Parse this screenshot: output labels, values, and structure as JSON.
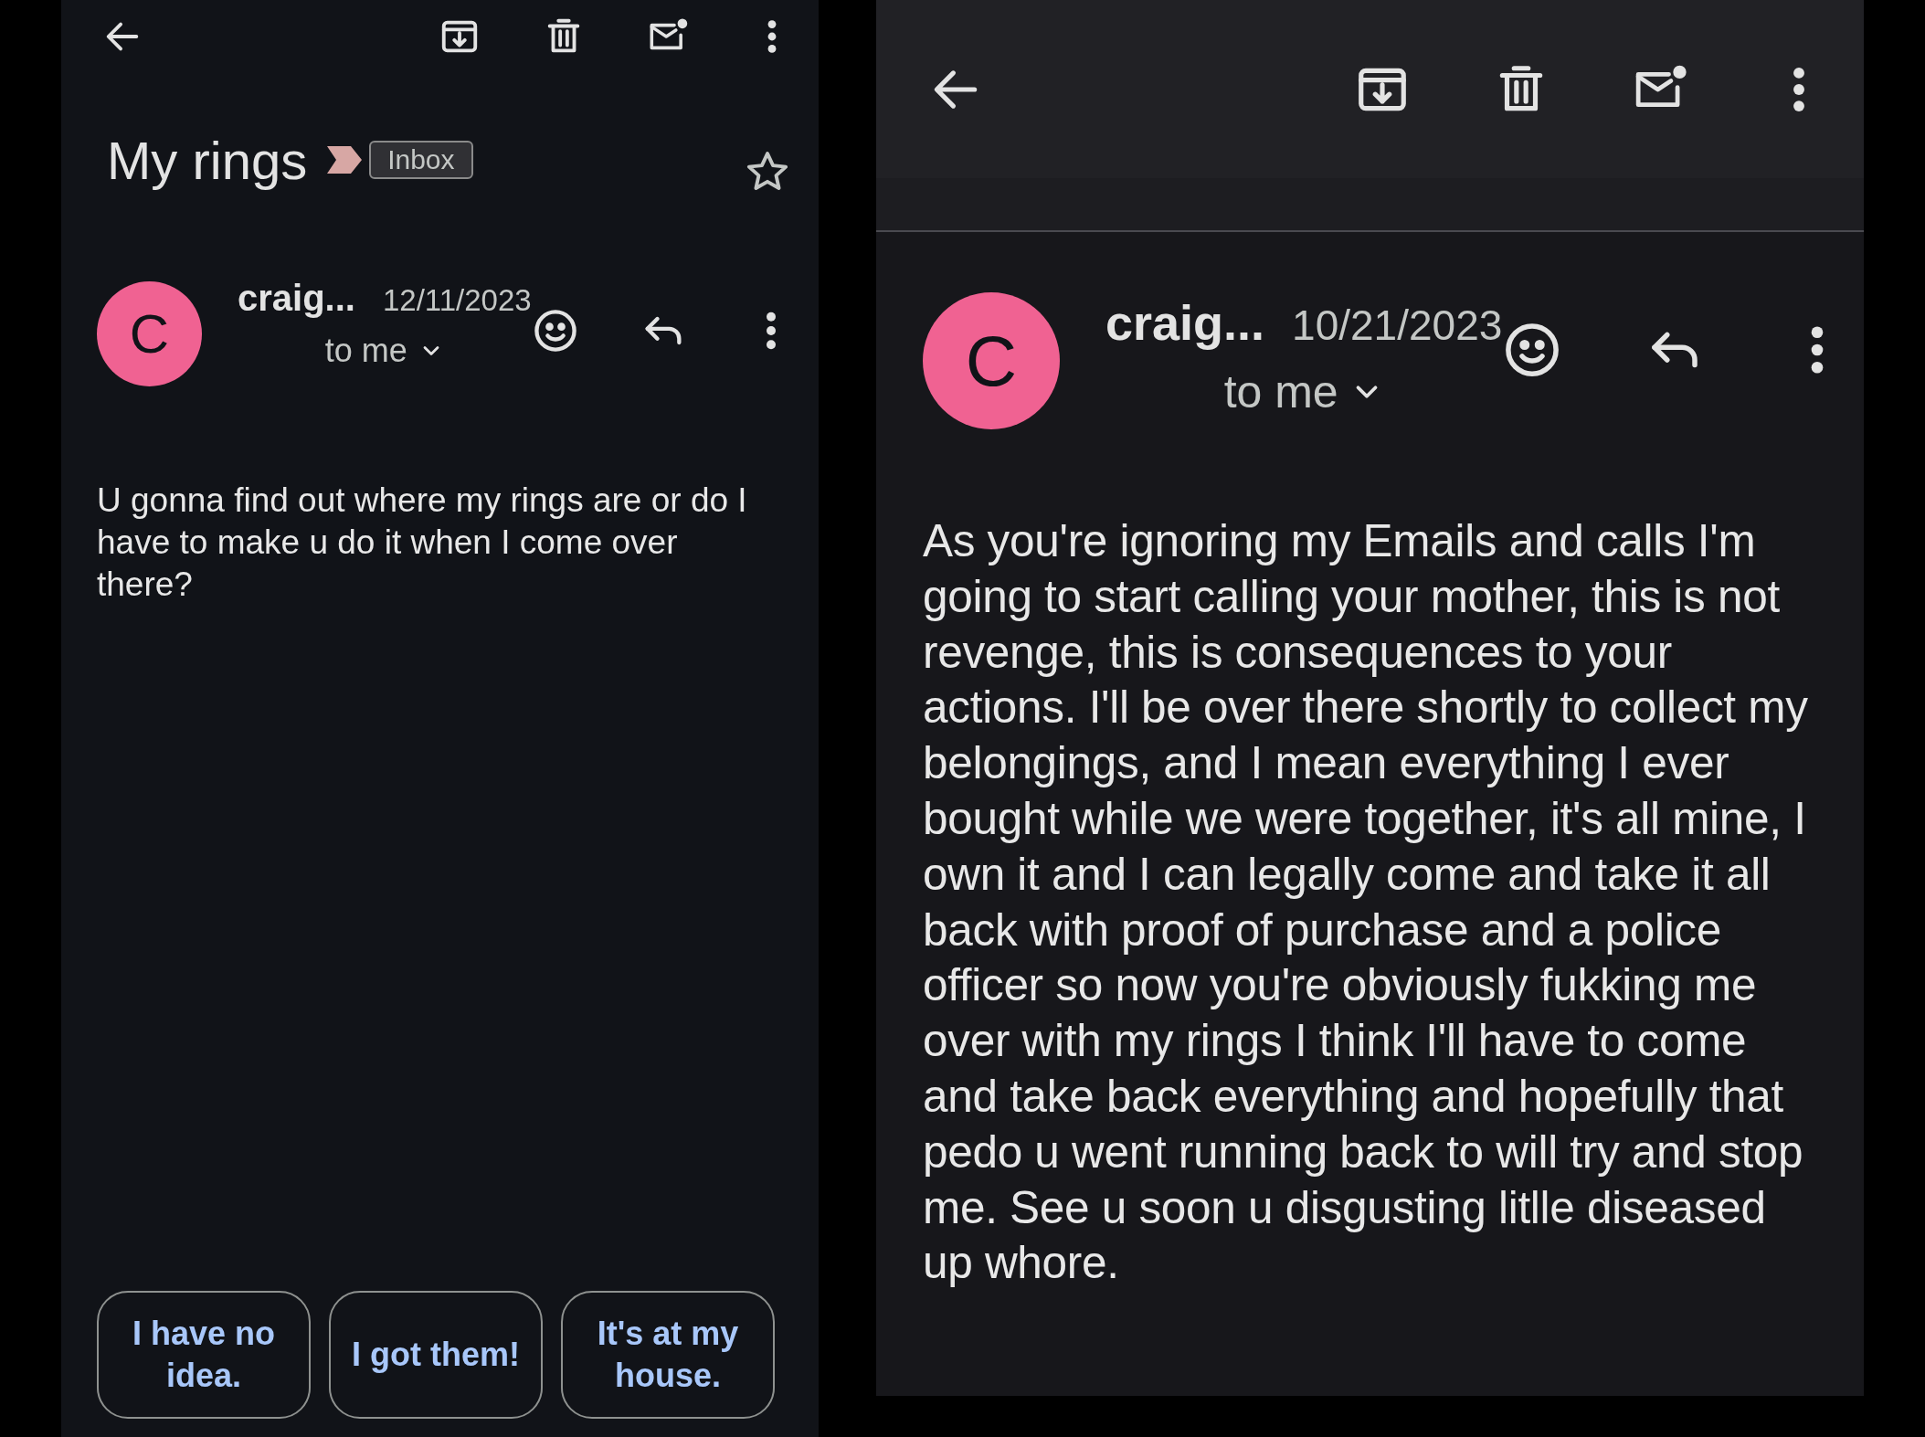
{
  "panels": [
    {
      "subject": "My rings",
      "label": "Inbox",
      "starred": false,
      "sender": {
        "initial": "C",
        "name": "craig...",
        "date": "12/11/2023",
        "recipient": "to me",
        "color": "#f06292"
      },
      "body": "U gonna find out where my rings are or do I have to make u do it when I come over there?",
      "smart_replies": [
        "I have no idea.",
        "I got them!",
        "It's at my house."
      ]
    },
    {
      "sender": {
        "initial": "C",
        "name": "craig...",
        "date": "10/21/2023",
        "recipient": "to me",
        "color": "#f06292"
      },
      "body": "As you're ignoring my Emails and calls I'm going to start calling your mother, this is not revenge, this is consequences to your actions. I'll be over there shortly to collect my belongings, and I mean everything I ever bought while we were together, it's all mine, I own it and I can legally come and take it all back with proof of purchase and a police officer so now you're obviously fukking me over with my rings I think I'll have to come and take back everything and hopefully that pedo u went running back to will try and stop me. See u soon u disgusting litlle diseased up whore."
    }
  ]
}
